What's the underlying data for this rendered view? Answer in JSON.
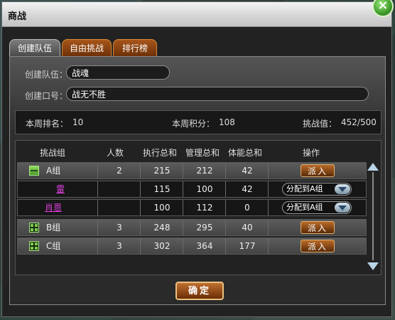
{
  "window": {
    "title": "商战",
    "close_glyph": "×"
  },
  "tabs": [
    {
      "label": "创建队伍",
      "active": true
    },
    {
      "label": "自由挑战",
      "active": false
    },
    {
      "label": "排行榜",
      "active": false
    }
  ],
  "form": {
    "team_label": "创建队伍：",
    "team_value": "战魂",
    "slogan_label": "创建口号：",
    "slogan_value": "战无不胜"
  },
  "stats": {
    "rank_label": "本周排名：",
    "rank_value": "10",
    "points_label": "本周积分：",
    "points_value": "108",
    "challenge_label": "挑战值：",
    "challenge_value": "452/500"
  },
  "table": {
    "headers": [
      "挑战组",
      "人数",
      "执行总和",
      "管理总和",
      "体能总和",
      "操作"
    ],
    "rows": [
      {
        "type": "group",
        "icon": "group-expanded-icon",
        "name": "A组",
        "count": "2",
        "exec": "215",
        "mgmt": "212",
        "stamina": "42",
        "action": "派入"
      },
      {
        "type": "member",
        "name": "雷",
        "exec": "115",
        "mgmt": "100",
        "stamina": "42",
        "select": "分配到A组"
      },
      {
        "type": "member",
        "name": "肖恩",
        "exec": "100",
        "mgmt": "112",
        "stamina": "0",
        "select": "分配到A组"
      },
      {
        "type": "group",
        "icon": "group-collapsed-icon",
        "name": "B组",
        "count": "3",
        "exec": "248",
        "mgmt": "295",
        "stamina": "40",
        "action": "派入"
      },
      {
        "type": "group",
        "icon": "group-collapsed-icon",
        "name": "C组",
        "count": "3",
        "exec": "302",
        "mgmt": "364",
        "stamina": "177",
        "action": "派入"
      }
    ]
  },
  "confirm_label": "确定",
  "colors": {
    "accent": "#b86a28",
    "member_name": "#e040e0",
    "title_bar": "#d6d6d6"
  }
}
